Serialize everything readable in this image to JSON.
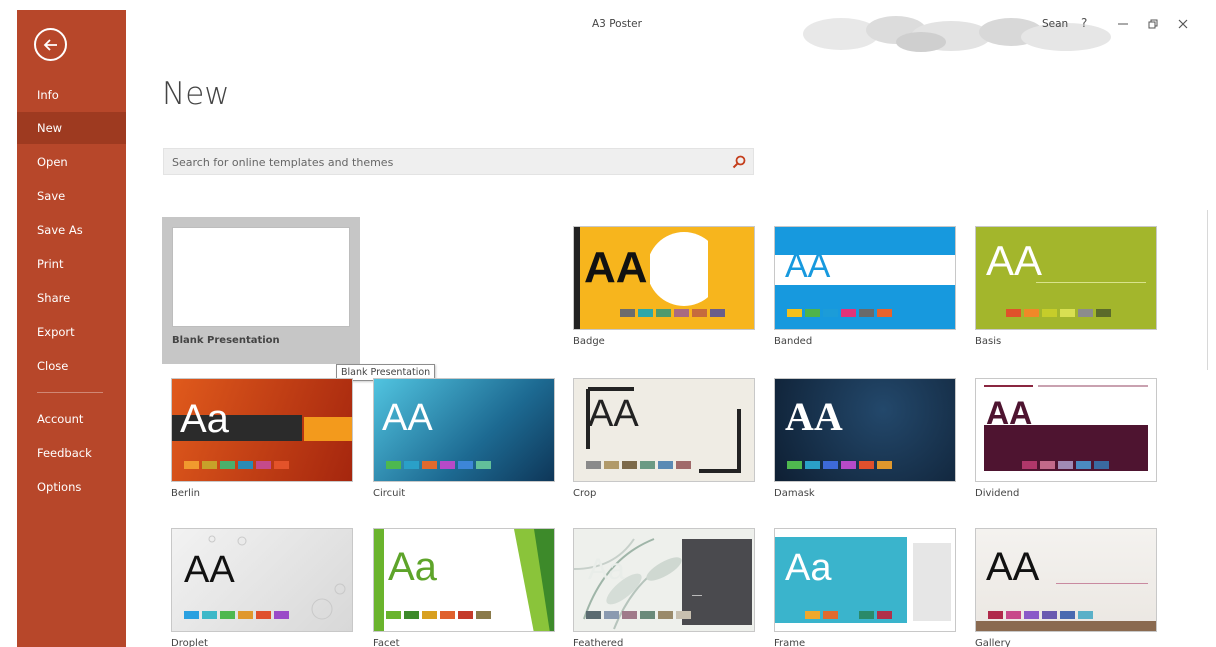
{
  "window": {
    "doc_title": "A3 Poster",
    "user_name": "Sean",
    "help": "?"
  },
  "sidebar": {
    "items": [
      {
        "label": "Info"
      },
      {
        "label": "New"
      },
      {
        "label": "Open"
      },
      {
        "label": "Save"
      },
      {
        "label": "Save As"
      },
      {
        "label": "Print"
      },
      {
        "label": "Share"
      },
      {
        "label": "Export"
      },
      {
        "label": "Close"
      },
      {
        "label": "Account"
      },
      {
        "label": "Feedback"
      },
      {
        "label": "Options"
      }
    ],
    "active": "New",
    "color": "#b7472a"
  },
  "main": {
    "heading": "New",
    "search": {
      "placeholder": "Search for online templates and themes"
    },
    "tooltip": "Blank Presentation",
    "templates": [
      {
        "name": "Blank Presentation"
      },
      {
        "name": "Badge",
        "title_text": "AA"
      },
      {
        "name": "Banded",
        "title_text": "AA"
      },
      {
        "name": "Basis",
        "title_text": "AA"
      },
      {
        "name": "Berlin",
        "title_text": "Aa"
      },
      {
        "name": "Circuit",
        "title_text": "AA"
      },
      {
        "name": "Crop",
        "title_text": "AA"
      },
      {
        "name": "Damask",
        "title_text": "AA"
      },
      {
        "name": "Dividend",
        "title_text": "AA"
      },
      {
        "name": "Droplet",
        "title_text": "AA"
      },
      {
        "name": "Facet",
        "title_text": "Aa"
      },
      {
        "name": "Feathered",
        "title_text": "Aa"
      },
      {
        "name": "Frame",
        "title_text": "Aa"
      },
      {
        "name": "Gallery",
        "title_text": "AA"
      }
    ]
  }
}
